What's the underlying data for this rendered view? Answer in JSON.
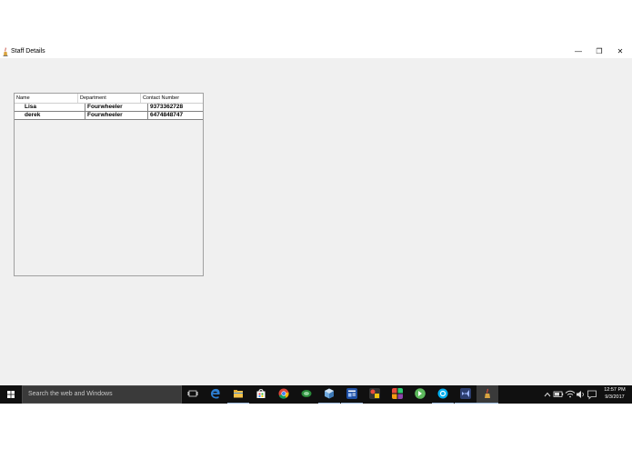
{
  "window": {
    "title": "Staff Details",
    "minimize_glyph": "—",
    "restore_glyph": "❐",
    "close_glyph": "✕"
  },
  "table": {
    "headers": [
      "Name",
      "Department",
      "Contact Number"
    ],
    "rows": [
      [
        "Lisa",
        "Fourwheeler",
        "9373362728"
      ],
      [
        "derek",
        "Fourwheeler",
        "6474848747"
      ]
    ]
  },
  "taskbar": {
    "search_placeholder": "Search the web and Windows",
    "apps": [
      "task-view-icon",
      "edge-icon",
      "file-explorer-icon",
      "store-icon",
      "chrome-icon",
      "xbox-icon",
      "3d-box-icon",
      "news-icon",
      "photo-editor-icon",
      "tiles-icon",
      "green-app-icon",
      "skype-icon",
      "visual-studio-icon",
      "java-app-icon"
    ],
    "time": "12:57 PM",
    "date": "9/3/2017"
  },
  "colors": {
    "taskbar": "#101010",
    "window_bg": "#f0f0f0",
    "accent_underline": "#9ab7d9"
  }
}
